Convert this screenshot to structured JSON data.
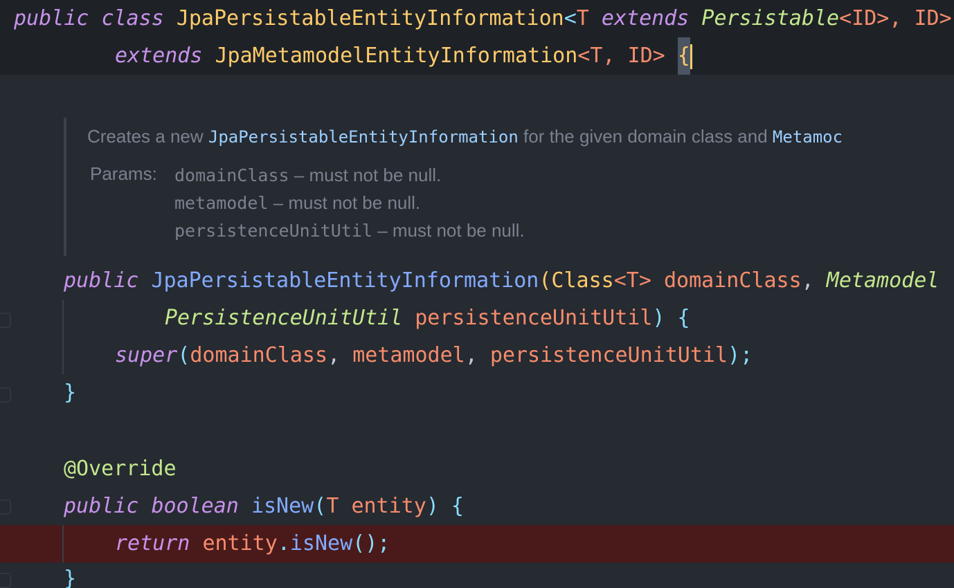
{
  "code": {
    "line1": {
      "kw1": "public",
      "kw2": "class",
      "class_name": "JpaPersistableEntityInformation",
      "lt": "<",
      "tparam": "T",
      "kw3": "extends",
      "bound": "Persistable",
      "bound_args": "<ID>, ID>"
    },
    "line2": {
      "kw": "extends",
      "super_class": "JpaMetamodelEntityInformation",
      "args": "<T, ID>",
      "brace": "{"
    },
    "doc": {
      "intro_prefix": "Creates a new ",
      "intro_code": "JpaPersistableEntityInformation",
      "intro_suffix": " for the given domain class and ",
      "intro_code2": "Metamoc",
      "params_label": "Params:",
      "p1_name": "domainClass",
      "p1_desc": " – must not be null.",
      "p2_name": "metamodel",
      "p2_desc": " – must not be null.",
      "p3_name": "persistenceUnitUtil",
      "p3_desc": " – must not be null."
    },
    "ctor": {
      "kw": "public",
      "name": "JpaPersistableEntityInformation",
      "open": "(",
      "type1": "Class",
      "type1_args": "<T>",
      "p1": "domainClass",
      "comma": ",",
      "type2": "Metamodel",
      "type3": "PersistenceUnitUtil",
      "p3": "persistenceUnitUtil",
      "close": ") {"
    },
    "super_call": {
      "kw": "super",
      "open": "(",
      "a1": "domainClass",
      "a2": "metamodel",
      "a3": "persistenceUnitUtil",
      "close": ");"
    },
    "close_brace": "}",
    "annotation": "@Override",
    "is_new": {
      "kw1": "public",
      "kw2": "boolean",
      "name": "isNew",
      "open": "(",
      "ptype": "T",
      "pname": "entity",
      "close": ") {"
    },
    "return_line": {
      "kw": "return",
      "obj": "entity",
      "dot": ".",
      "method": "isNew",
      "tail": "();"
    },
    "final_brace": "}"
  },
  "colors": {
    "background": "#262a31",
    "keyword": "#c792ea",
    "class_name": "#ffcb6b",
    "type_italic": "#c3e88d",
    "parameter": "#f78c6c",
    "method": "#82aaff",
    "punctuation": "#89ddff",
    "breakpoint_line": "#4a1a1b"
  }
}
